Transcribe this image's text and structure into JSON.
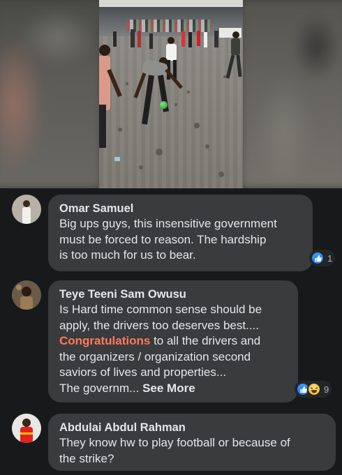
{
  "video": {
    "description_icon": "video-frame"
  },
  "comments": [
    {
      "author": "Omar Samuel",
      "lines": [
        "Big ups guys, this insensitive government",
        "must be forced to reason. The hardship",
        "is too much for us to bear."
      ],
      "reactions": {
        "icons": [
          "like-icon"
        ],
        "count": "1"
      }
    },
    {
      "author": "Teye Teeni Sam Owusu",
      "lines": [
        "Is Hard time common sense should be",
        "apply, the drivers too deserves best....",
        "to all the drivers  and",
        "the organizers / organization second",
        "saviors of lives and properties...",
        "The governm..."
      ],
      "highlight_word": "Congratulations",
      "see_more": "See More",
      "reactions": {
        "icons": [
          "like-icon",
          "haha-icon"
        ],
        "count": "9"
      }
    },
    {
      "author": "Abdulai Abdul Rahman",
      "lines": [
        "They know hw to play football or because of",
        "the strike?"
      ]
    }
  ],
  "colors": {
    "background": "#18191a",
    "bubble": "#3a3b3c",
    "text": "#e4e6eb",
    "highlight": "#ff7b5b",
    "like_blue": "#1877f2"
  }
}
